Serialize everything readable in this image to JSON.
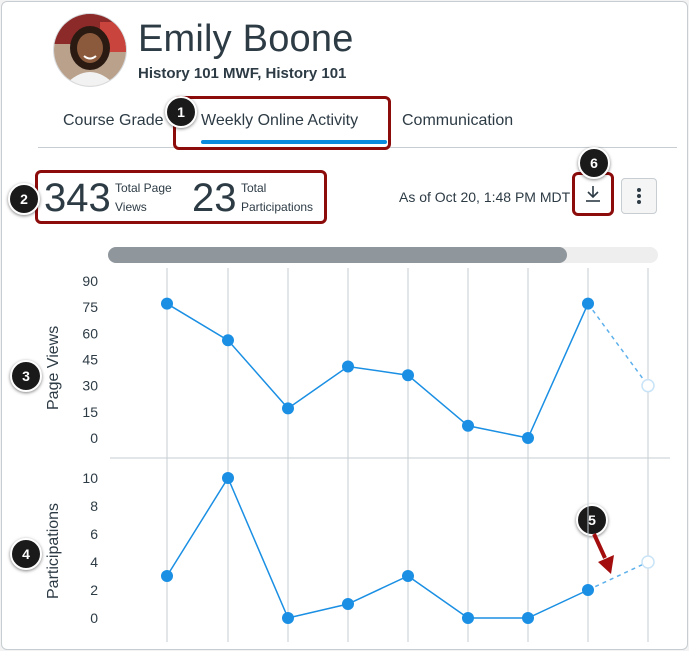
{
  "student": {
    "name": "Emily Boone",
    "courses": "History 101 MWF, History 101"
  },
  "tabs": [
    {
      "label": "Course Grade"
    },
    {
      "label": "Weekly Online Activity",
      "active": true
    },
    {
      "label": "Communication"
    }
  ],
  "stats": {
    "page_views_value": "343",
    "page_views_label_1": "Total Page",
    "page_views_label_2": "Views",
    "participations_value": "23",
    "participations_label_1": "Total",
    "participations_label_2": "Participations"
  },
  "as_of": "As of Oct 20, 1:48 PM MDT",
  "icons": {
    "download": "download-icon",
    "menu": "kebab-menu-icon"
  },
  "scrollbar": {
    "fraction": 0.835
  },
  "callouts": [
    "1",
    "2",
    "3",
    "4",
    "5",
    "6"
  ],
  "colors": {
    "accent": "#0b8bde",
    "point": "#1a8fe3",
    "callout_border": "#8c0b0b",
    "arrow": "#a30d0d",
    "text": "#2d3b45"
  },
  "chart_data": [
    {
      "type": "line",
      "ylabel": "Page Views",
      "yticks": [
        "90",
        "75",
        "60",
        "45",
        "30",
        "15",
        "0"
      ],
      "ylim": [
        0,
        90
      ],
      "values": [
        77,
        56,
        17,
        41,
        36,
        7,
        0,
        77
      ],
      "projected": 30,
      "grid": true
    },
    {
      "type": "line",
      "ylabel": "Participations",
      "yticks": [
        "10",
        "8",
        "6",
        "4",
        "2",
        "0"
      ],
      "ylim": [
        0,
        10
      ],
      "values": [
        3,
        10,
        0,
        1,
        3,
        0,
        0,
        2
      ],
      "projected": 4,
      "grid": true
    }
  ]
}
